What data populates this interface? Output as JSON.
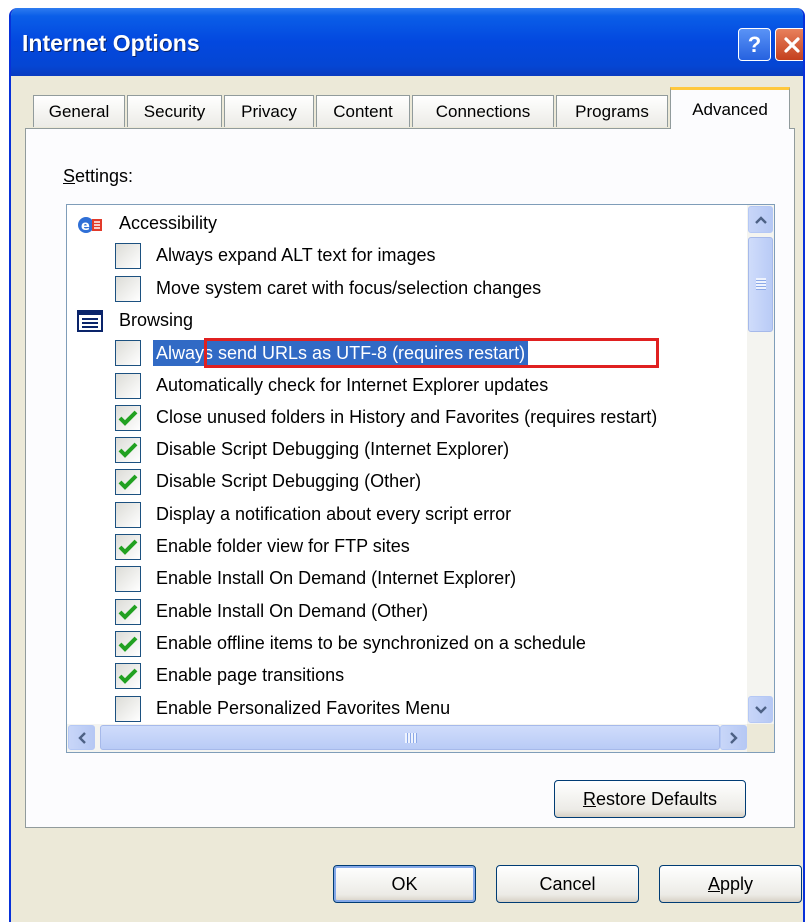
{
  "window": {
    "title": "Internet Options"
  },
  "tabs": [
    {
      "label": "General",
      "active": false
    },
    {
      "label": "Security",
      "active": false
    },
    {
      "label": "Privacy",
      "active": false
    },
    {
      "label": "Content",
      "active": false
    },
    {
      "label": "Connections",
      "active": false
    },
    {
      "label": "Programs",
      "active": false
    },
    {
      "label": "Advanced",
      "active": true
    }
  ],
  "settings": {
    "label_prefix": "S",
    "label_rest": "ettings:",
    "rows": [
      {
        "type": "category",
        "icon": "accessibility-icon",
        "label": "Accessibility"
      },
      {
        "type": "item",
        "checked": false,
        "label": "Always expand ALT text for images"
      },
      {
        "type": "item",
        "checked": false,
        "label": "Move system caret with focus/selection changes"
      },
      {
        "type": "category",
        "icon": "browsing-icon",
        "label": "Browsing"
      },
      {
        "type": "item",
        "checked": false,
        "selected": true,
        "label": "Always send URLs as UTF-8 (requires restart)"
      },
      {
        "type": "item",
        "checked": false,
        "label": "Automatically check for Internet Explorer updates"
      },
      {
        "type": "item",
        "checked": true,
        "label": "Close unused folders in History and Favorites (requires restart)"
      },
      {
        "type": "item",
        "checked": true,
        "label": "Disable Script Debugging (Internet Explorer)"
      },
      {
        "type": "item",
        "checked": true,
        "label": "Disable Script Debugging (Other)"
      },
      {
        "type": "item",
        "checked": false,
        "label": "Display a notification about every script error"
      },
      {
        "type": "item",
        "checked": true,
        "label": "Enable folder view for FTP sites"
      },
      {
        "type": "item",
        "checked": false,
        "label": "Enable Install On Demand (Internet Explorer)"
      },
      {
        "type": "item",
        "checked": true,
        "label": "Enable Install On Demand (Other)"
      },
      {
        "type": "item",
        "checked": true,
        "label": "Enable offline items to be synchronized on a schedule"
      },
      {
        "type": "item",
        "checked": true,
        "label": "Enable page transitions"
      },
      {
        "type": "item",
        "checked": false,
        "label": "Enable Personalized Favorites Menu"
      }
    ]
  },
  "buttons": {
    "restore_prefix": "R",
    "restore_rest": "estore Defaults",
    "ok": "OK",
    "cancel": "Cancel",
    "apply_prefix": "A",
    "apply_rest": "pply"
  },
  "colors": {
    "titlebar": "#0348DF",
    "selection": "#316AC5",
    "checkmark": "#21A121",
    "annotation": "#E02020"
  }
}
